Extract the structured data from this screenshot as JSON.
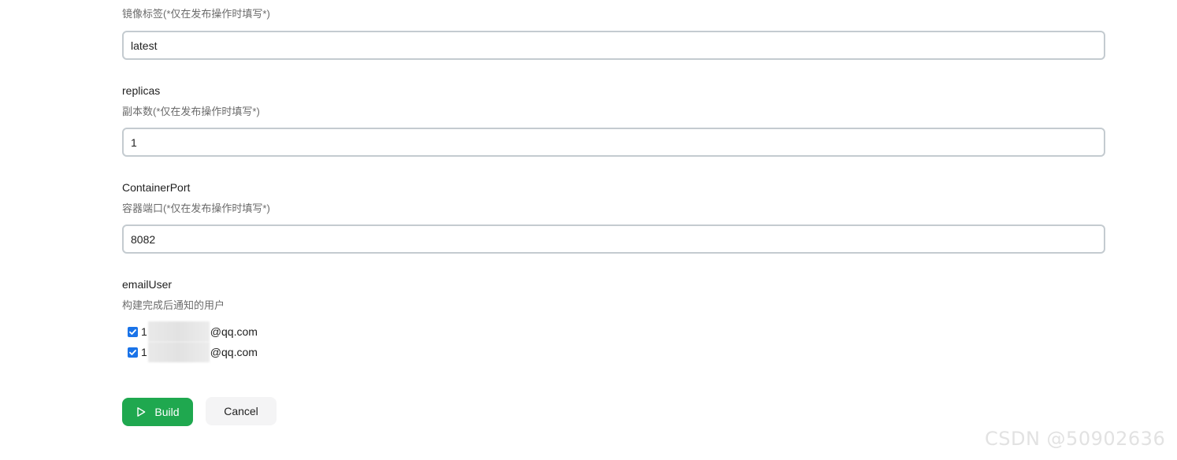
{
  "params": [
    {
      "name": "",
      "description": "镜像标签(*仅在发布操作时填写*)",
      "value": "latest"
    },
    {
      "name": "replicas",
      "description": "副本数(*仅在发布操作时填写*)",
      "value": "1"
    },
    {
      "name": "ContainerPort",
      "description": "容器端口(*仅在发布操作时填写*)",
      "value": "8082"
    }
  ],
  "email": {
    "name": "emailUser",
    "description": "构建完成后通知的用户",
    "options": [
      {
        "prefix": "1",
        "suffix": "@qq.com",
        "checked": true
      },
      {
        "prefix": "1",
        "suffix": "@qq.com",
        "checked": true
      }
    ]
  },
  "actions": {
    "build_label": "Build",
    "cancel_label": "Cancel"
  },
  "colors": {
    "build": "#1fa84f",
    "checkbox": "#1a73e8",
    "input_border": "#c4cbd0"
  },
  "icons": {
    "build": "play-outline-icon",
    "checkbox": "checkmark-icon"
  },
  "watermark": "CSDN @50902636"
}
